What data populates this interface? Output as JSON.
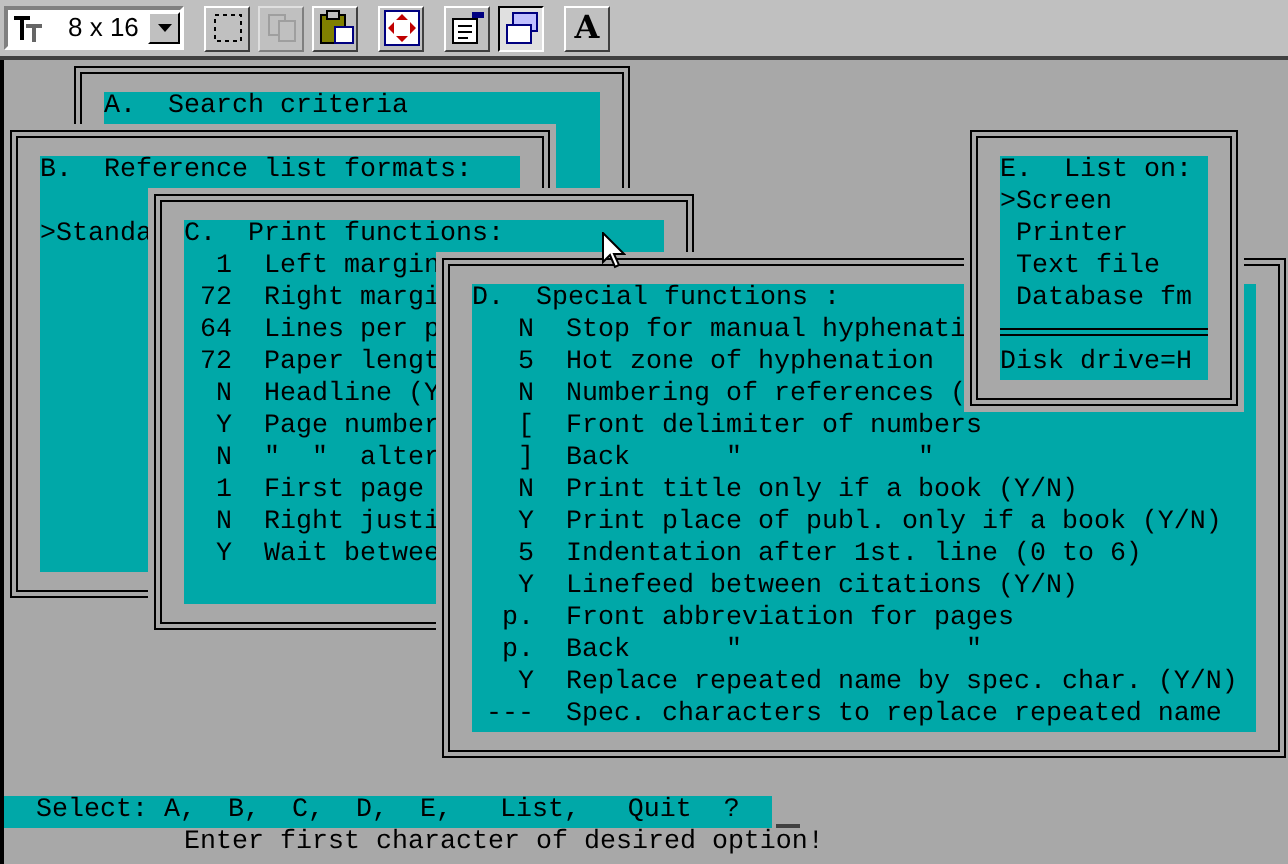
{
  "toolbar": {
    "font_size": "8 x 16",
    "buttons": [
      {
        "kind": "mark",
        "disabled": false,
        "pressed": false
      },
      {
        "kind": "copy",
        "disabled": true,
        "pressed": false
      },
      {
        "kind": "paste",
        "disabled": false,
        "pressed": false
      },
      {
        "kind": "fullscreen",
        "disabled": false,
        "pressed": false
      },
      {
        "kind": "properties",
        "disabled": false,
        "pressed": false
      },
      {
        "kind": "background",
        "disabled": false,
        "pressed": true
      },
      {
        "kind": "font",
        "disabled": false,
        "pressed": false,
        "label": "A"
      }
    ]
  },
  "panels": [
    {
      "kind": "title_only",
      "title": "A.  Search criteria"
    },
    {
      "kind": "list",
      "title": "B.  Reference list formats:",
      "lines": [
        ">Standa"
      ]
    },
    {
      "kind": "settings",
      "title": "C.  Print functions:",
      "rows": [
        {
          "value": "1",
          "label": "Left margin"
        },
        {
          "value": "72",
          "label": "Right margi"
        },
        {
          "value": "64",
          "label": "Lines per p"
        },
        {
          "value": "72",
          "label": "Paper lengt"
        },
        {
          "value": "N",
          "label": "Headline (Y"
        },
        {
          "value": "Y",
          "label": "Page number"
        },
        {
          "value": "N",
          "label": "\"  \"  alter"
        },
        {
          "value": "1",
          "label": "First page"
        },
        {
          "value": "N",
          "label": "Right justi"
        },
        {
          "value": "Y",
          "label": "Wait betwee"
        }
      ]
    },
    {
      "kind": "settings",
      "title": "D.  Special functions :",
      "rows": [
        {
          "value": "N",
          "label": "Stop for manual hyphenati"
        },
        {
          "value": "5",
          "label": "Hot zone of hyphenation"
        },
        {
          "value": "N",
          "label": "Numbering of references ("
        },
        {
          "value": "[",
          "label": "Front delimiter of numbers"
        },
        {
          "value": "]",
          "label": "Back      \"           \""
        },
        {
          "value": "N",
          "label": "Print title only if a book (Y/N)"
        },
        {
          "value": "Y",
          "label": "Print place of publ. only if a book (Y/N)"
        },
        {
          "value": "5",
          "label": "Indentation after 1st. line (0 to 6)"
        },
        {
          "value": "Y",
          "label": "Linefeed between citations (Y/N)"
        },
        {
          "value": "p.",
          "label": "Front abbreviation for pages"
        },
        {
          "value": "p.",
          "label": "Back      \"              \""
        },
        {
          "value": "Y",
          "label": "Replace repeated name by spec. char. (Y/N)"
        },
        {
          "value": "---",
          "label": "Spec. characters to replace repeated name"
        }
      ]
    },
    {
      "kind": "menu",
      "title": "E.  List on:",
      "lines": [
        ">Screen",
        " Printer",
        " Text file",
        " Database fm"
      ],
      "footer": "Disk drive=H"
    }
  ],
  "status": {
    "prompt": "Select: A,  B,  C,  D,  E,   List,   Quit  ?",
    "hint": "Enter first character of desired option!"
  }
}
